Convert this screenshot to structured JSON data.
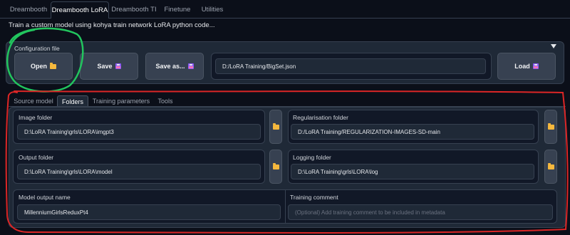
{
  "top_tabs": [
    "Dreambooth",
    "Dreambooth LoRA",
    "Dreambooth TI",
    "Finetune",
    "Utilities"
  ],
  "description": "Train a custom model using kohya train network LoRA python code...",
  "config": {
    "label": "Configuration file",
    "open_label": "Open",
    "save_label": "Save",
    "save_as_label": "Save as...",
    "path_value": "D:/LoRA Training/BigSet.json",
    "load_label": "Load"
  },
  "inner_tabs": [
    "Source model",
    "Folders",
    "Training parameters",
    "Tools"
  ],
  "folders": {
    "image_folder": {
      "label": "Image folder",
      "value": "D:\\LoRA Training\\grls\\LORA\\imgpt3"
    },
    "regularisation_folder": {
      "label": "Regularisation folder",
      "value": "D:/LoRA Training/REGULARIZATION-IMAGES-SD-main"
    },
    "output_folder": {
      "label": "Output folder",
      "value": "D:\\LoRA Training\\grls\\LORA\\model"
    },
    "logging_folder": {
      "label": "Logging folder",
      "value": "D:\\LoRA Training\\grls\\LORA\\log"
    },
    "model_output_name": {
      "label": "Model output name",
      "value": "MillenniumGirlsReduxPt4"
    },
    "training_comment": {
      "label": "Training comment",
      "placeholder": "(Optional) Add training comment to be included in metadata"
    }
  },
  "colors": {
    "background": "#0b0f19",
    "panel": "#1f2937",
    "annotation_green": "#22c55e",
    "annotation_red": "#dc2626",
    "folder_icon": "#f5b83d"
  },
  "icons": [
    "folder-icon",
    "floppy-disk-icon",
    "dropdown-caret-icon"
  ]
}
